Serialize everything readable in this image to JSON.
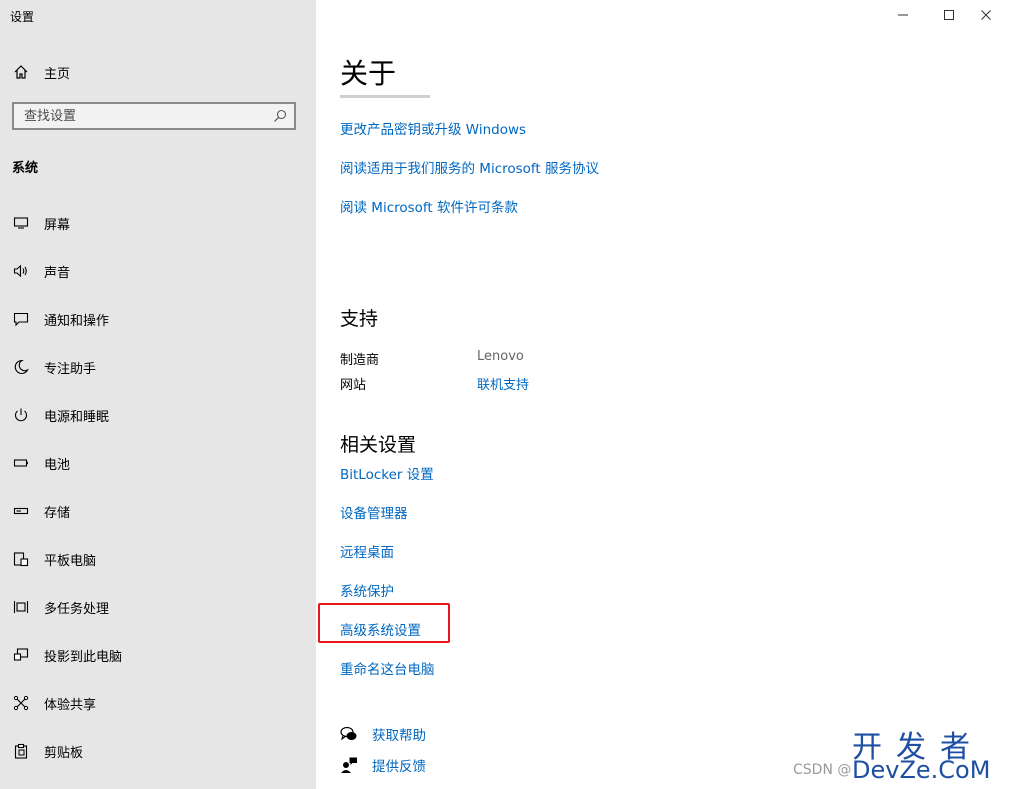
{
  "window": {
    "title": "设置",
    "controls": {
      "minimize": "minimize-icon",
      "maximize": "maximize-icon",
      "close": "close-icon"
    }
  },
  "sidebar": {
    "home_label": "主页",
    "search_placeholder": "查找设置",
    "section_label": "系统",
    "items": [
      {
        "label": "屏幕",
        "icon": "display-icon"
      },
      {
        "label": "声音",
        "icon": "speaker-icon"
      },
      {
        "label": "通知和操作",
        "icon": "notification-icon"
      },
      {
        "label": "专注助手",
        "icon": "moon-icon"
      },
      {
        "label": "电源和睡眠",
        "icon": "power-icon"
      },
      {
        "label": "电池",
        "icon": "battery-icon"
      },
      {
        "label": "存储",
        "icon": "storage-icon"
      },
      {
        "label": "平板电脑",
        "icon": "tablet-icon"
      },
      {
        "label": "多任务处理",
        "icon": "multitask-icon"
      },
      {
        "label": "投影到此电脑",
        "icon": "project-icon"
      },
      {
        "label": "体验共享",
        "icon": "share-icon"
      },
      {
        "label": "剪贴板",
        "icon": "clipboard-icon"
      }
    ]
  },
  "main": {
    "title": "关于",
    "links_top": [
      "更改产品密钥或升级 Windows",
      "阅读适用于我们服务的 Microsoft 服务协议",
      "阅读 Microsoft 软件许可条款"
    ],
    "support": {
      "heading": "支持",
      "manufacturer_key": "制造商",
      "manufacturer_value": "Lenovo",
      "website_key": "网站",
      "website_value": "联机支持"
    },
    "related": {
      "heading": "相关设置",
      "links": [
        "BitLocker 设置",
        "设备管理器",
        "远程桌面",
        "系统保护",
        "高级系统设置",
        "重命名这台电脑"
      ]
    },
    "help": {
      "get_help": "获取帮助",
      "feedback": "提供反馈"
    },
    "highlight_color": "#e8151b",
    "link_color": "#0067c0"
  },
  "watermark": {
    "csdn": "CSDN @",
    "brand_top": "开发者",
    "brand_bottom": "DevZe.CoM"
  }
}
